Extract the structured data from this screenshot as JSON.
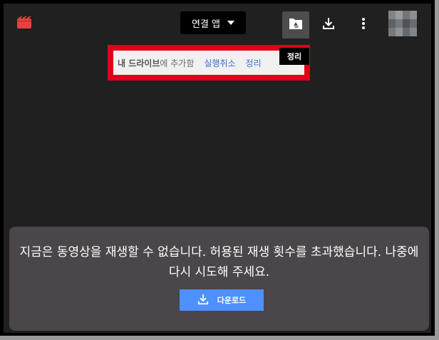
{
  "toolbar": {
    "connect_apps_label": "연결 앱",
    "icons": {
      "file": "movie-file-icon",
      "add_to_drive": "add-to-drive-icon",
      "download": "download-icon",
      "more": "more-vert-icon"
    }
  },
  "toast": {
    "bold_text": "내 드라이브",
    "text": "에 추가함",
    "undo_label": "실행취소",
    "organize_label": "정리"
  },
  "tooltip": {
    "text": "정리"
  },
  "message": {
    "text": "지금은 동영상을 재생할 수 없습니다. 허용된 재생 횟수를 초과했습니다. 나중에 다시 시도해 주세요.",
    "download_label": "다운로드"
  },
  "colors": {
    "background": "#202020",
    "highlight": "#e0001a",
    "link": "#3b6fd6",
    "download_button": "#4d90fe",
    "message_box": "#4b4649"
  }
}
